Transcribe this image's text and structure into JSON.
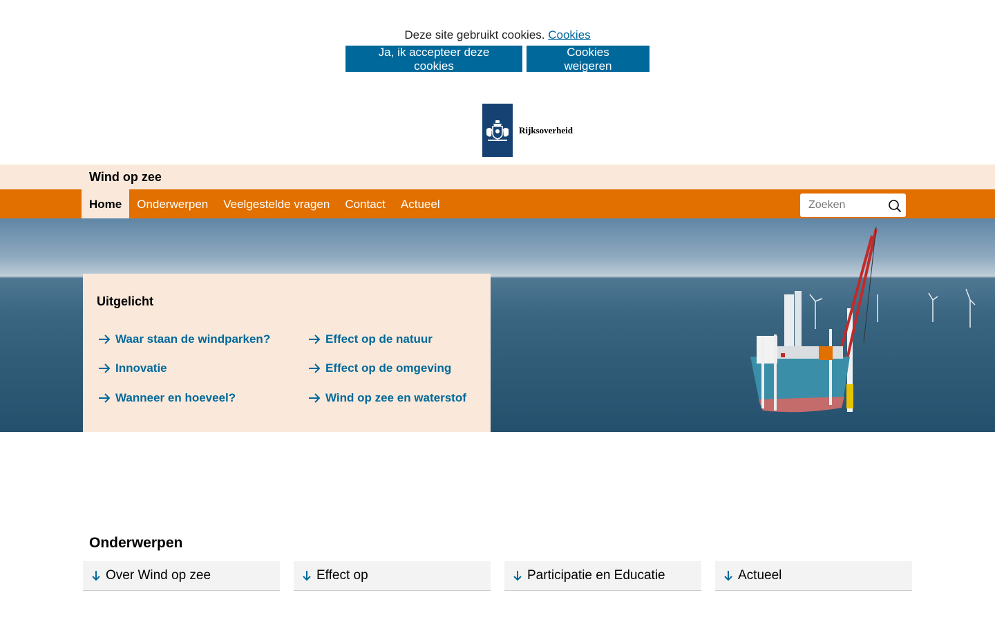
{
  "cookie": {
    "text": "Deze site gebruikt cookies.",
    "link": "Cookies",
    "accept_label": "Ja, ik accepteer deze cookies",
    "refuse_label": "Cookies weigeren"
  },
  "logo": {
    "text": "Rijksoverheid"
  },
  "site": {
    "title": "Wind op zee"
  },
  "nav": {
    "items": [
      {
        "label": "Home"
      },
      {
        "label": "Onderwerpen"
      },
      {
        "label": "Veelgestelde vragen"
      },
      {
        "label": "Contact"
      },
      {
        "label": "Actueel"
      }
    ],
    "search_placeholder": "Zoeken"
  },
  "featured": {
    "title": "Uitgelicht",
    "links": [
      {
        "label": "Waar staan de windparken?"
      },
      {
        "label": "Effect op de natuur"
      },
      {
        "label": "Innovatie"
      },
      {
        "label": "Effect op de omgeving"
      },
      {
        "label": "Wanneer en hoeveel?"
      },
      {
        "label": "Wind op zee en waterstof"
      }
    ]
  },
  "topics": {
    "title": "Onderwerpen",
    "tiles": [
      {
        "label": "Over Wind op zee"
      },
      {
        "label": "Effect op"
      },
      {
        "label": "Participatie en Educatie"
      },
      {
        "label": "Actueel"
      }
    ]
  },
  "colors": {
    "brand_blue": "#01689b",
    "orange": "#e17000",
    "cream": "#fae9da",
    "logo_blue": "#154273"
  }
}
